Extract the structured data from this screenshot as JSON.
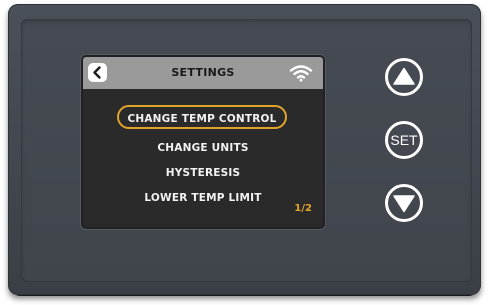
{
  "screen": {
    "title": "SETTINGS",
    "back_icon": "chevron-left-icon",
    "status_icon": "wifi-icon",
    "menu": [
      {
        "label": "CHANGE TEMP CONTROL",
        "selected": true
      },
      {
        "label": "CHANGE UNITS",
        "selected": false
      },
      {
        "label": "HYSTERESIS",
        "selected": false
      },
      {
        "label": "LOWER TEMP LIMIT",
        "selected": false
      }
    ],
    "page_indicator": "1/2"
  },
  "buttons": {
    "up_icon": "triangle-up-icon",
    "set_label": "SET",
    "down_icon": "triangle-down-icon"
  },
  "colors": {
    "highlight": "#e2a32a",
    "header_bg": "#9a9a9a",
    "screen_bg": "#2a2a2b",
    "housing": "#454a52"
  }
}
